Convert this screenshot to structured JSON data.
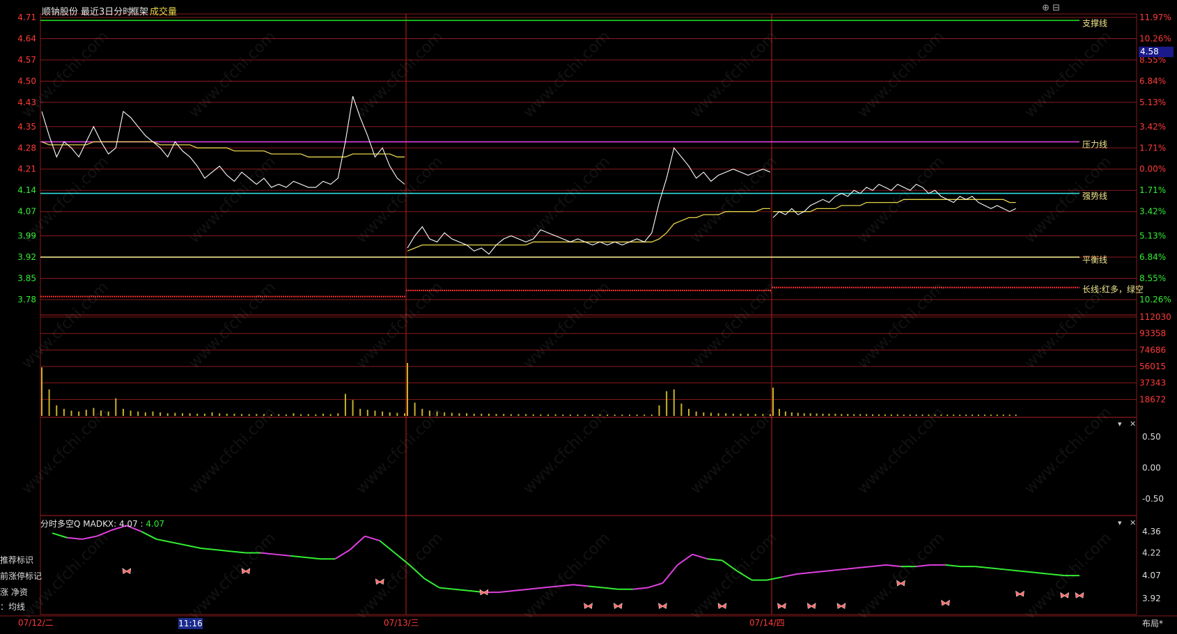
{
  "header": {
    "stock_name": "顺钠股份",
    "range_label": "最近3日分时",
    "frame_label": "框架",
    "volume_label": "成交量",
    "window_icons": "⊕ ⊟"
  },
  "current_price_tag": "4.58",
  "indicator": {
    "title": "分时多空Q  MADKX: 4.07 :",
    "value": "4.07",
    "side_labels": [
      "推荐标识",
      "前涨停标记",
      "涨  净资",
      "：均线"
    ]
  },
  "layout_button": "布局*",
  "highlight_time": "11:16",
  "colors": {
    "background": "#000000",
    "grid": "#8a1a1a",
    "price_line": "#ffffff",
    "avg_line": "#e8d44a",
    "support": "#22dd22",
    "pressure": "#e040e0",
    "strong": "#33dddd",
    "balance": "#f0e68c",
    "volume": "#c8b22a",
    "up_color": "#ff3b3b",
    "down_color": "#33ee33"
  },
  "chart_data": [
    {
      "type": "line",
      "title": "最近3日分时",
      "y_ticks_left": [
        "4.71",
        "4.64",
        "4.57",
        "4.50",
        "4.43",
        "4.35",
        "4.28",
        "4.21",
        "4.14",
        "4.07",
        "3.99",
        "3.92",
        "3.85",
        "3.78"
      ],
      "y_ticks_right": [
        "11.97%",
        "10.26%",
        "8.55%",
        "6.84%",
        "5.13%",
        "3.42%",
        "1.71%",
        "0.00%",
        "1.71%",
        "3.42%",
        "5.13%",
        "6.84%",
        "8.55%",
        "10.26%"
      ],
      "ylim": [
        3.78,
        4.71
      ],
      "days": [
        "07/12/二",
        "07/13/三",
        "07/14/四"
      ],
      "reference_lines": [
        {
          "name": "支撑线",
          "value": 4.7
        },
        {
          "name": "压力线",
          "value": 4.3
        },
        {
          "name": "强势线",
          "value": 4.13
        },
        {
          "name": "平衡线",
          "value": 3.92
        },
        {
          "name": "长线:红多，绿空",
          "value": 3.81
        }
      ],
      "price_series": [
        4.4,
        4.32,
        4.25,
        4.3,
        4.28,
        4.25,
        4.3,
        4.35,
        4.3,
        4.26,
        4.28,
        4.4,
        4.38,
        4.35,
        4.32,
        4.3,
        4.28,
        4.25,
        4.3,
        4.27,
        4.25,
        4.22,
        4.18,
        4.2,
        4.22,
        4.19,
        4.17,
        4.2,
        4.18,
        4.16,
        4.18,
        4.15,
        4.16,
        4.15,
        4.17,
        4.16,
        4.15,
        4.15,
        4.17,
        4.16,
        4.18,
        4.3,
        4.45,
        4.38,
        4.32,
        4.25,
        4.28,
        4.22,
        4.18,
        4.16,
        3.95,
        3.99,
        4.02,
        3.98,
        3.97,
        4.0,
        3.98,
        3.97,
        3.96,
        3.94,
        3.95,
        3.93,
        3.96,
        3.98,
        3.99,
        3.98,
        3.97,
        3.98,
        4.01,
        4.0,
        3.99,
        3.98,
        3.97,
        3.98,
        3.97,
        3.96,
        3.97,
        3.96,
        3.97,
        3.96,
        3.97,
        3.98,
        3.97,
        4.0,
        4.1,
        4.18,
        4.28,
        4.25,
        4.22,
        4.18,
        4.2,
        4.17,
        4.19,
        4.2,
        4.21,
        4.2,
        4.19,
        4.2,
        4.21,
        4.2,
        4.05,
        4.07,
        4.06,
        4.08,
        4.06,
        4.07,
        4.09,
        4.1,
        4.11,
        4.1,
        4.12,
        4.13,
        4.12,
        4.14,
        4.13,
        4.15,
        4.14,
        4.16,
        4.15,
        4.14,
        4.16,
        4.15,
        4.14,
        4.16,
        4.15,
        4.13,
        4.14,
        4.12,
        4.11,
        4.1,
        4.12,
        4.11,
        4.12,
        4.1,
        4.09,
        4.08,
        4.09,
        4.08,
        4.07,
        4.08
      ],
      "avg_series": [
        4.3,
        4.29,
        4.29,
        4.29,
        4.29,
        4.29,
        4.29,
        4.3,
        4.3,
        4.3,
        4.3,
        4.3,
        4.3,
        4.3,
        4.3,
        4.3,
        4.29,
        4.29,
        4.29,
        4.29,
        4.29,
        4.28,
        4.28,
        4.28,
        4.28,
        4.28,
        4.27,
        4.27,
        4.27,
        4.27,
        4.27,
        4.26,
        4.26,
        4.26,
        4.26,
        4.26,
        4.25,
        4.25,
        4.25,
        4.25,
        4.25,
        4.25,
        4.26,
        4.26,
        4.26,
        4.26,
        4.26,
        4.26,
        4.25,
        4.25,
        3.94,
        3.95,
        3.96,
        3.96,
        3.96,
        3.96,
        3.96,
        3.96,
        3.96,
        3.96,
        3.96,
        3.96,
        3.96,
        3.96,
        3.96,
        3.96,
        3.96,
        3.97,
        3.97,
        3.97,
        3.97,
        3.97,
        3.97,
        3.97,
        3.97,
        3.97,
        3.97,
        3.97,
        3.97,
        3.97,
        3.97,
        3.97,
        3.97,
        3.97,
        3.98,
        4.0,
        4.03,
        4.04,
        4.05,
        4.05,
        4.06,
        4.06,
        4.06,
        4.07,
        4.07,
        4.07,
        4.07,
        4.07,
        4.08,
        4.08,
        4.07,
        4.07,
        4.07,
        4.07,
        4.07,
        4.07,
        4.07,
        4.08,
        4.08,
        4.08,
        4.08,
        4.09,
        4.09,
        4.09,
        4.09,
        4.1,
        4.1,
        4.1,
        4.1,
        4.1,
        4.1,
        4.11,
        4.11,
        4.11,
        4.11,
        4.11,
        4.11,
        4.11,
        4.11,
        4.11,
        4.11,
        4.11,
        4.11,
        4.11,
        4.11,
        4.11,
        4.11,
        4.11,
        4.1,
        4.1
      ]
    },
    {
      "type": "bar",
      "title": "成交量",
      "y_ticks": [
        "112030",
        "93358",
        "74686",
        "56015",
        "37343",
        "18672"
      ],
      "ylim": [
        0,
        112030
      ],
      "values": [
        55000,
        30000,
        12000,
        8000,
        6000,
        5000,
        7000,
        9000,
        6000,
        5000,
        20000,
        8000,
        6000,
        5000,
        4000,
        5000,
        4000,
        3000,
        3500,
        3000,
        3000,
        2500,
        2500,
        4000,
        2800,
        2500,
        2500,
        2200,
        2000,
        2200,
        2000,
        1800,
        2000,
        1800,
        3000,
        2000,
        2000,
        1800,
        2500,
        2000,
        3000,
        25000,
        18000,
        8000,
        7000,
        6000,
        5000,
        4000,
        3500,
        3000,
        60000,
        15000,
        8000,
        6000,
        5000,
        4000,
        3500,
        3000,
        3000,
        2500,
        2500,
        2500,
        2200,
        2200,
        2000,
        2000,
        2000,
        1800,
        1800,
        1800,
        1800,
        1600,
        1600,
        1600,
        1500,
        1500,
        1500,
        1500,
        1500,
        1500,
        1500,
        1500,
        1500,
        1600,
        12000,
        28000,
        30000,
        14000,
        8000,
        5000,
        4000,
        3500,
        3000,
        3000,
        2500,
        2500,
        2500,
        2200,
        2200,
        2000,
        32000,
        8000,
        5000,
        4000,
        3500,
        3000,
        3000,
        2800,
        2500,
        2500,
        2500,
        2200,
        2200,
        2000,
        2000,
        2000,
        1800,
        1800,
        1800,
        1800,
        1800,
        1600,
        1600,
        1600,
        1600,
        1600,
        1500,
        1500,
        1500,
        1500,
        1500,
        1500,
        1500,
        1500,
        1500,
        1500,
        1500,
        1500,
        1500,
        1500
      ]
    },
    {
      "type": "line",
      "title": "",
      "y_ticks": [
        "0.50",
        "0.00",
        "-0.50"
      ],
      "ylim": [
        -0.75,
        0.75
      ],
      "values": []
    },
    {
      "type": "line",
      "title": "分时多空Q MADKX",
      "y_ticks": [
        "4.36",
        "4.22",
        "4.07",
        "3.92"
      ],
      "ylim": [
        3.85,
        4.42
      ],
      "values": [
        4.35,
        4.32,
        4.31,
        4.33,
        4.37,
        4.4,
        4.36,
        4.31,
        4.29,
        4.27,
        4.25,
        4.24,
        4.23,
        4.22,
        4.22,
        4.21,
        4.2,
        4.19,
        4.18,
        4.18,
        4.24,
        4.33,
        4.3,
        4.22,
        4.14,
        4.05,
        3.99,
        3.98,
        3.97,
        3.96,
        3.96,
        3.97,
        3.98,
        3.99,
        4.0,
        4.01,
        4.0,
        3.99,
        3.98,
        3.98,
        3.99,
        4.02,
        4.14,
        4.21,
        4.18,
        4.17,
        4.1,
        4.04,
        4.04,
        4.06,
        4.08,
        4.09,
        4.1,
        4.11,
        4.12,
        4.13,
        4.14,
        4.13,
        4.13,
        4.14,
        4.14,
        4.13,
        4.13,
        4.12,
        4.11,
        4.1,
        4.09,
        4.08,
        4.07,
        4.07
      ],
      "trend": [
        "down",
        "up",
        "up",
        "up",
        "up",
        "up",
        "down",
        "down",
        "down",
        "down",
        "down",
        "down",
        "down",
        "down",
        "up",
        "up",
        "down",
        "down",
        "down",
        "up",
        "up",
        "up",
        "down",
        "down",
        "down",
        "down",
        "down",
        "down",
        "down",
        "up",
        "up",
        "up",
        "up",
        "up",
        "up",
        "up",
        "down",
        "down",
        "down",
        "up",
        "up",
        "up",
        "up",
        "up",
        "down",
        "down",
        "down",
        "down",
        "down",
        "up",
        "up",
        "up",
        "up",
        "up",
        "up",
        "up",
        "up",
        "down",
        "up",
        "up",
        "down",
        "down",
        "down",
        "down",
        "down",
        "down",
        "down",
        "down",
        "down",
        "down"
      ],
      "markers": [
        {
          "i": 5,
          "v": 4.1
        },
        {
          "i": 13,
          "v": 4.1
        },
        {
          "i": 22,
          "v": 4.03
        },
        {
          "i": 29,
          "v": 3.96
        },
        {
          "i": 36,
          "v": 3.87
        },
        {
          "i": 38,
          "v": 3.87
        },
        {
          "i": 41,
          "v": 3.87
        },
        {
          "i": 45,
          "v": 3.87
        },
        {
          "i": 49,
          "v": 3.87
        },
        {
          "i": 51,
          "v": 3.87
        },
        {
          "i": 53,
          "v": 3.87
        },
        {
          "i": 57,
          "v": 4.02
        },
        {
          "i": 60,
          "v": 3.89
        },
        {
          "i": 65,
          "v": 3.95
        },
        {
          "i": 68,
          "v": 3.94
        },
        {
          "i": 69,
          "v": 3.94
        }
      ]
    }
  ]
}
